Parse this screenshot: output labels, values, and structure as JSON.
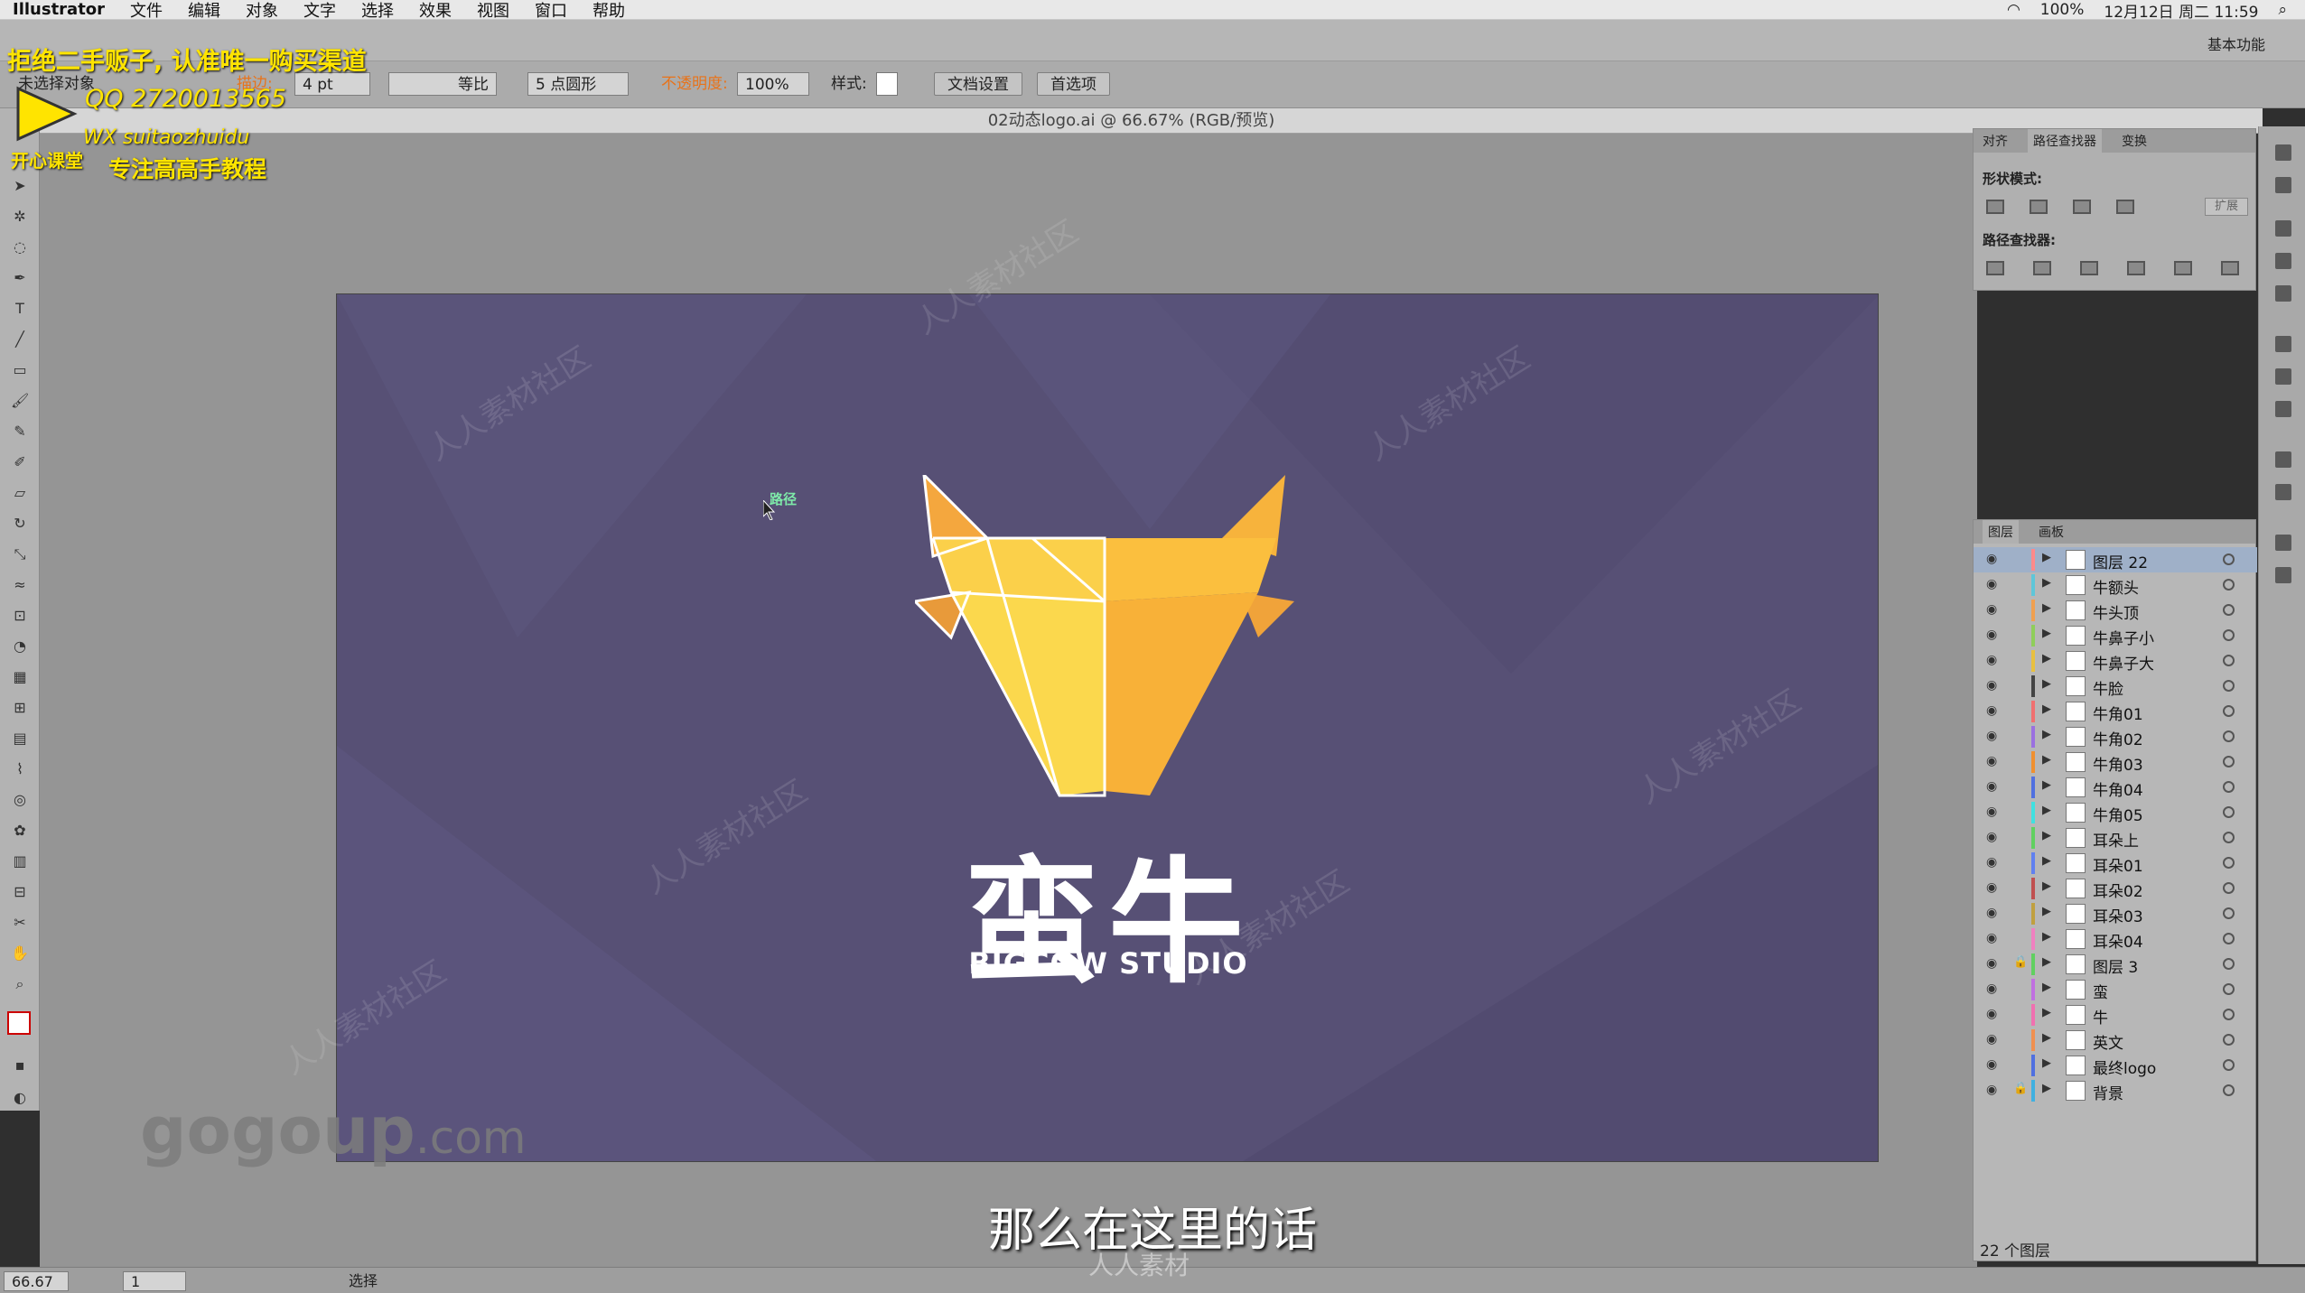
{
  "menubar": {
    "app": "Illustrator",
    "items": [
      "文件",
      "编辑",
      "对象",
      "文字",
      "选择",
      "效果",
      "视图",
      "窗口",
      "帮助"
    ],
    "zoom_pct": "100%",
    "datetime": "12月12日 周二 11:59"
  },
  "workspace_label": "基本功能",
  "control": {
    "selection": "未选择对象",
    "stroke_label": "描边:",
    "stroke_value": "4 pt",
    "profile": "等比",
    "brush": "5 点圆形",
    "opacity_label": "不透明度:",
    "opacity_value": "100%",
    "style_label": "样式:",
    "doc_setup": "文档设置",
    "prefs": "首选项"
  },
  "doc_tab": "02动态logo.ai @ 66.67% (RGB/预览)",
  "artboard": {
    "brand_cn": "蛮牛",
    "brand_en": "BIGCOW   STUDIO",
    "hover_label": "路径",
    "bg_color": "#575075"
  },
  "pathfinder": {
    "tabs": [
      "对齐",
      "路径查找器",
      "变换"
    ],
    "active_tab": "路径查找器",
    "shape_modes": "形状模式:",
    "expand": "扩展",
    "pathfinders": "路径查找器:"
  },
  "layers_panel": {
    "tabs": [
      "图层",
      "画板"
    ],
    "rows": [
      {
        "name": "图层 22",
        "color": "#ff8a8a",
        "lock": false,
        "selected": true
      },
      {
        "name": "牛额头",
        "color": "#5ec6d9",
        "lock": false
      },
      {
        "name": "牛头顶",
        "color": "#f0a050",
        "lock": false
      },
      {
        "name": "牛鼻子小",
        "color": "#8fce5a",
        "lock": false
      },
      {
        "name": "牛鼻子大",
        "color": "#e8c040",
        "lock": false
      },
      {
        "name": "牛脸",
        "color": "#444",
        "lock": false
      },
      {
        "name": "牛角01",
        "color": "#f07070",
        "lock": false
      },
      {
        "name": "牛角02",
        "color": "#9a70e0",
        "lock": false
      },
      {
        "name": "牛角03",
        "color": "#f09030",
        "lock": false
      },
      {
        "name": "牛角04",
        "color": "#5070e0",
        "lock": false
      },
      {
        "name": "牛角05",
        "color": "#40e0e0",
        "lock": false
      },
      {
        "name": "耳朵上",
        "color": "#60d060",
        "lock": false
      },
      {
        "name": "耳朵01",
        "color": "#6080f0",
        "lock": false
      },
      {
        "name": "耳朵02",
        "color": "#c05050",
        "lock": false
      },
      {
        "name": "耳朵03",
        "color": "#c0a040",
        "lock": false
      },
      {
        "name": "耳朵04",
        "color": "#f080c0",
        "lock": false
      },
      {
        "name": "图层 3",
        "color": "#60d060",
        "lock": true
      },
      {
        "name": "蛮",
        "color": "#c070e0",
        "lock": false
      },
      {
        "name": "牛",
        "color": "#f070b0",
        "lock": false
      },
      {
        "name": "英文",
        "color": "#f09050",
        "lock": false
      },
      {
        "name": "最终logo",
        "color": "#5070e0",
        "lock": false
      },
      {
        "name": "背景",
        "color": "#40b0e0",
        "lock": true
      }
    ],
    "footer": "22 个图层"
  },
  "statusbar": {
    "zoom": "66.67",
    "page": "1",
    "tool": "选择"
  },
  "overlay": {
    "line1": "拒绝二手贩子, 认准唯一购买渠道",
    "line2": "QQ 2720013565",
    "line3": "WX  suitaozhuidu",
    "line4": "专注高高手教程",
    "line5": "开心课堂",
    "site": "gogoup",
    "site_suffix": ".com",
    "watermark": "人人素材社区",
    "bottom_mark": "人人素材"
  },
  "subtitle": "那么在这里的话"
}
